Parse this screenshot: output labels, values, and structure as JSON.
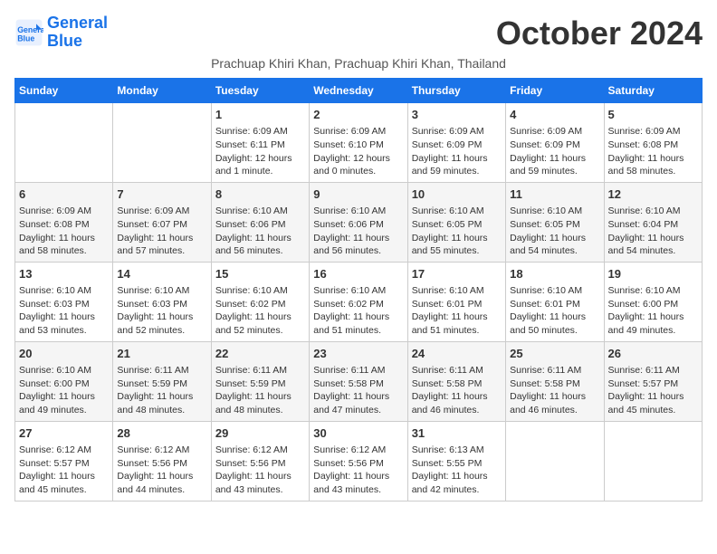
{
  "header": {
    "logo_line1": "General",
    "logo_line2": "Blue",
    "month_title": "October 2024",
    "subtitle": "Prachuap Khiri Khan, Prachuap Khiri Khan, Thailand"
  },
  "days_of_week": [
    "Sunday",
    "Monday",
    "Tuesday",
    "Wednesday",
    "Thursday",
    "Friday",
    "Saturday"
  ],
  "weeks": [
    [
      {
        "day": "",
        "sunrise": "",
        "sunset": "",
        "daylight": ""
      },
      {
        "day": "",
        "sunrise": "",
        "sunset": "",
        "daylight": ""
      },
      {
        "day": "1",
        "sunrise": "Sunrise: 6:09 AM",
        "sunset": "Sunset: 6:11 PM",
        "daylight": "Daylight: 12 hours and 1 minute."
      },
      {
        "day": "2",
        "sunrise": "Sunrise: 6:09 AM",
        "sunset": "Sunset: 6:10 PM",
        "daylight": "Daylight: 12 hours and 0 minutes."
      },
      {
        "day": "3",
        "sunrise": "Sunrise: 6:09 AM",
        "sunset": "Sunset: 6:09 PM",
        "daylight": "Daylight: 11 hours and 59 minutes."
      },
      {
        "day": "4",
        "sunrise": "Sunrise: 6:09 AM",
        "sunset": "Sunset: 6:09 PM",
        "daylight": "Daylight: 11 hours and 59 minutes."
      },
      {
        "day": "5",
        "sunrise": "Sunrise: 6:09 AM",
        "sunset": "Sunset: 6:08 PM",
        "daylight": "Daylight: 11 hours and 58 minutes."
      }
    ],
    [
      {
        "day": "6",
        "sunrise": "Sunrise: 6:09 AM",
        "sunset": "Sunset: 6:08 PM",
        "daylight": "Daylight: 11 hours and 58 minutes."
      },
      {
        "day": "7",
        "sunrise": "Sunrise: 6:09 AM",
        "sunset": "Sunset: 6:07 PM",
        "daylight": "Daylight: 11 hours and 57 minutes."
      },
      {
        "day": "8",
        "sunrise": "Sunrise: 6:10 AM",
        "sunset": "Sunset: 6:06 PM",
        "daylight": "Daylight: 11 hours and 56 minutes."
      },
      {
        "day": "9",
        "sunrise": "Sunrise: 6:10 AM",
        "sunset": "Sunset: 6:06 PM",
        "daylight": "Daylight: 11 hours and 56 minutes."
      },
      {
        "day": "10",
        "sunrise": "Sunrise: 6:10 AM",
        "sunset": "Sunset: 6:05 PM",
        "daylight": "Daylight: 11 hours and 55 minutes."
      },
      {
        "day": "11",
        "sunrise": "Sunrise: 6:10 AM",
        "sunset": "Sunset: 6:05 PM",
        "daylight": "Daylight: 11 hours and 54 minutes."
      },
      {
        "day": "12",
        "sunrise": "Sunrise: 6:10 AM",
        "sunset": "Sunset: 6:04 PM",
        "daylight": "Daylight: 11 hours and 54 minutes."
      }
    ],
    [
      {
        "day": "13",
        "sunrise": "Sunrise: 6:10 AM",
        "sunset": "Sunset: 6:03 PM",
        "daylight": "Daylight: 11 hours and 53 minutes."
      },
      {
        "day": "14",
        "sunrise": "Sunrise: 6:10 AM",
        "sunset": "Sunset: 6:03 PM",
        "daylight": "Daylight: 11 hours and 52 minutes."
      },
      {
        "day": "15",
        "sunrise": "Sunrise: 6:10 AM",
        "sunset": "Sunset: 6:02 PM",
        "daylight": "Daylight: 11 hours and 52 minutes."
      },
      {
        "day": "16",
        "sunrise": "Sunrise: 6:10 AM",
        "sunset": "Sunset: 6:02 PM",
        "daylight": "Daylight: 11 hours and 51 minutes."
      },
      {
        "day": "17",
        "sunrise": "Sunrise: 6:10 AM",
        "sunset": "Sunset: 6:01 PM",
        "daylight": "Daylight: 11 hours and 51 minutes."
      },
      {
        "day": "18",
        "sunrise": "Sunrise: 6:10 AM",
        "sunset": "Sunset: 6:01 PM",
        "daylight": "Daylight: 11 hours and 50 minutes."
      },
      {
        "day": "19",
        "sunrise": "Sunrise: 6:10 AM",
        "sunset": "Sunset: 6:00 PM",
        "daylight": "Daylight: 11 hours and 49 minutes."
      }
    ],
    [
      {
        "day": "20",
        "sunrise": "Sunrise: 6:10 AM",
        "sunset": "Sunset: 6:00 PM",
        "daylight": "Daylight: 11 hours and 49 minutes."
      },
      {
        "day": "21",
        "sunrise": "Sunrise: 6:11 AM",
        "sunset": "Sunset: 5:59 PM",
        "daylight": "Daylight: 11 hours and 48 minutes."
      },
      {
        "day": "22",
        "sunrise": "Sunrise: 6:11 AM",
        "sunset": "Sunset: 5:59 PM",
        "daylight": "Daylight: 11 hours and 48 minutes."
      },
      {
        "day": "23",
        "sunrise": "Sunrise: 6:11 AM",
        "sunset": "Sunset: 5:58 PM",
        "daylight": "Daylight: 11 hours and 47 minutes."
      },
      {
        "day": "24",
        "sunrise": "Sunrise: 6:11 AM",
        "sunset": "Sunset: 5:58 PM",
        "daylight": "Daylight: 11 hours and 46 minutes."
      },
      {
        "day": "25",
        "sunrise": "Sunrise: 6:11 AM",
        "sunset": "Sunset: 5:58 PM",
        "daylight": "Daylight: 11 hours and 46 minutes."
      },
      {
        "day": "26",
        "sunrise": "Sunrise: 6:11 AM",
        "sunset": "Sunset: 5:57 PM",
        "daylight": "Daylight: 11 hours and 45 minutes."
      }
    ],
    [
      {
        "day": "27",
        "sunrise": "Sunrise: 6:12 AM",
        "sunset": "Sunset: 5:57 PM",
        "daylight": "Daylight: 11 hours and 45 minutes."
      },
      {
        "day": "28",
        "sunrise": "Sunrise: 6:12 AM",
        "sunset": "Sunset: 5:56 PM",
        "daylight": "Daylight: 11 hours and 44 minutes."
      },
      {
        "day": "29",
        "sunrise": "Sunrise: 6:12 AM",
        "sunset": "Sunset: 5:56 PM",
        "daylight": "Daylight: 11 hours and 43 minutes."
      },
      {
        "day": "30",
        "sunrise": "Sunrise: 6:12 AM",
        "sunset": "Sunset: 5:56 PM",
        "daylight": "Daylight: 11 hours and 43 minutes."
      },
      {
        "day": "31",
        "sunrise": "Sunrise: 6:13 AM",
        "sunset": "Sunset: 5:55 PM",
        "daylight": "Daylight: 11 hours and 42 minutes."
      },
      {
        "day": "",
        "sunrise": "",
        "sunset": "",
        "daylight": ""
      },
      {
        "day": "",
        "sunrise": "",
        "sunset": "",
        "daylight": ""
      }
    ]
  ]
}
